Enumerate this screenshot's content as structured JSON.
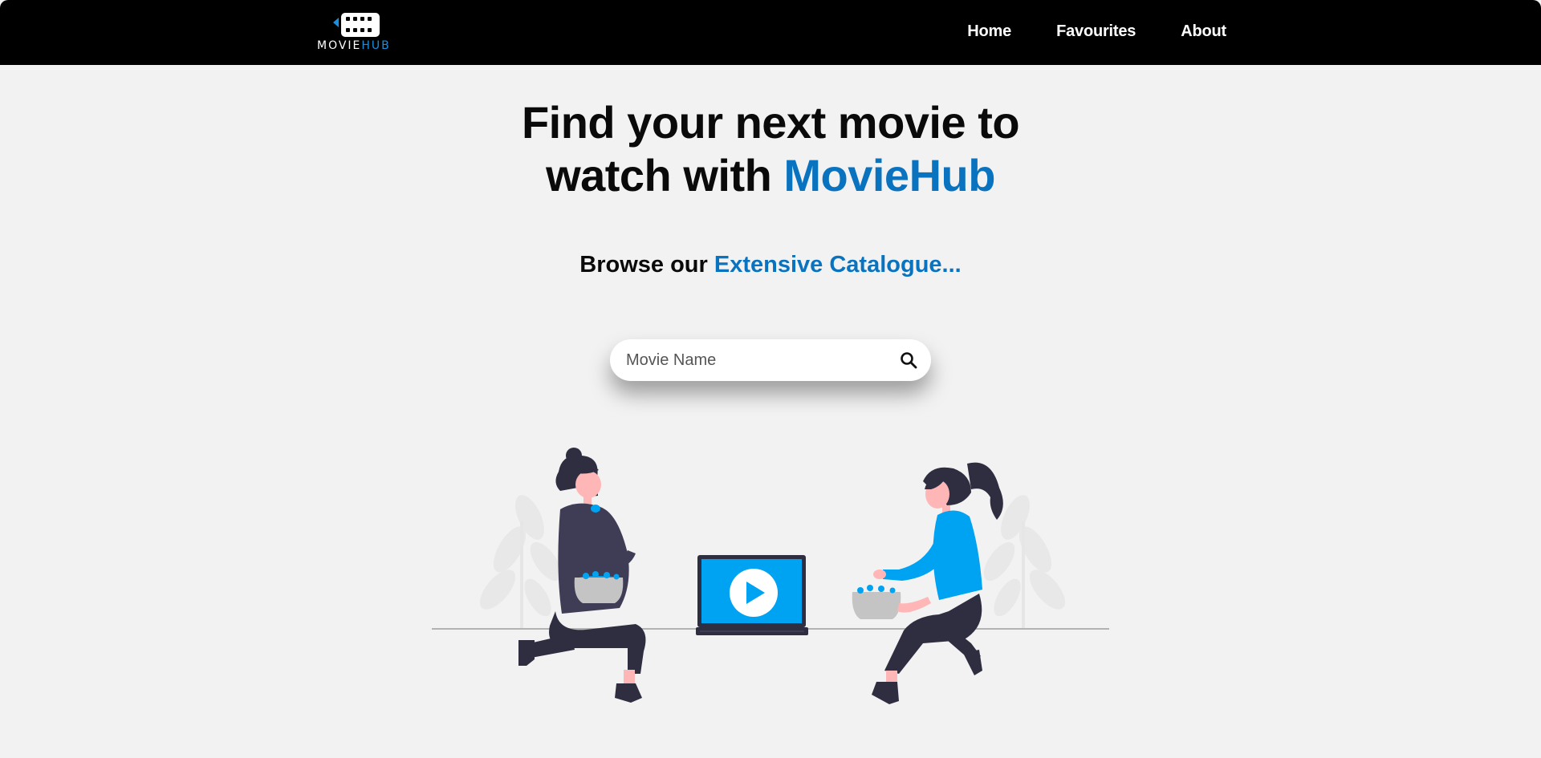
{
  "navbar": {
    "logo": {
      "text_main": "MOVIE",
      "text_accent": "HUB",
      "icon": "film-reel-icon"
    },
    "links": [
      {
        "label": "Home"
      },
      {
        "label": "Favourites"
      },
      {
        "label": "About"
      }
    ]
  },
  "hero": {
    "title_line1": "Find your next movie to",
    "title_line2_prefix": "watch with ",
    "title_brand": "MovieHub"
  },
  "subtitle": {
    "prefix": "Browse our ",
    "accent": "Extensive Catalogue..."
  },
  "search": {
    "placeholder": "Movie Name",
    "value": "",
    "icon": "search-icon"
  },
  "illustration": {
    "icon": "people-watching-movie-illustration",
    "laptop_icon": "play-button-icon"
  },
  "colors": {
    "navbar_bg": "#000000",
    "page_bg": "#f2f2f2",
    "brand_blue": "#0a73bf",
    "logo_blue": "#1a8fe0",
    "illustration_blue": "#00a2f2",
    "dark_clothes": "#2f2e41"
  }
}
